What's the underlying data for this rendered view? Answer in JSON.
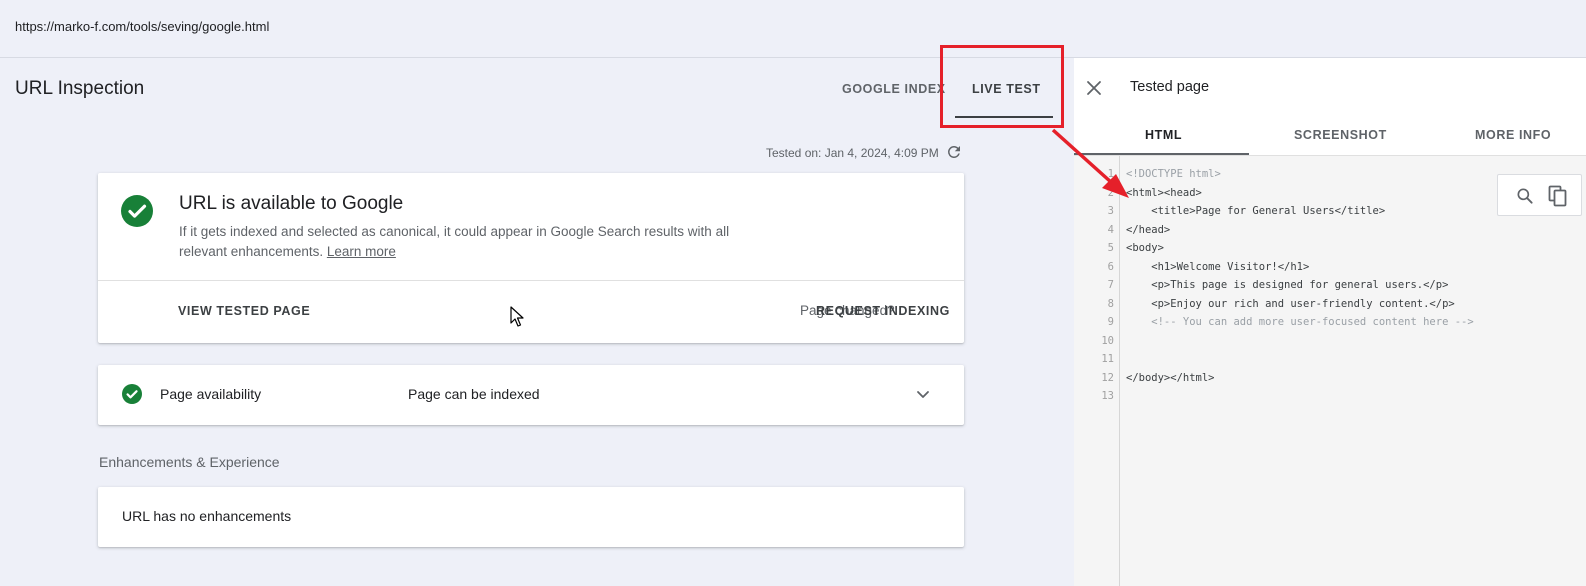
{
  "address_bar": {
    "url": "https://marko-f.com/tools/seving/google.html"
  },
  "header": {
    "title": "URL Inspection",
    "tabs": [
      {
        "label": "GOOGLE INDEX"
      },
      {
        "label": "LIVE TEST",
        "selected": true
      }
    ]
  },
  "test_info": {
    "tested_on": "Tested on: Jan 4, 2024, 4:09 PM"
  },
  "status_card": {
    "title": "URL is available to Google",
    "description": "If it gets indexed and selected as canonical, it could appear in Google Search results with all relevant enhancements.",
    "learn_more": "Learn more",
    "view_tested_page": "VIEW TESTED PAGE",
    "page_changed": "Page changed?",
    "request_indexing": "REQUEST INDEXING"
  },
  "availability": {
    "label": "Page availability",
    "value": "Page can be indexed"
  },
  "enhancements": {
    "section_title": "Enhancements & Experience",
    "message": "URL has no enhancements"
  },
  "side_panel": {
    "title": "Tested page",
    "tabs": [
      {
        "label": "HTML",
        "selected": true
      },
      {
        "label": "SCREENSHOT"
      },
      {
        "label": "MORE INFO"
      }
    ],
    "code_lines": [
      {
        "num": "1",
        "text": "<!DOCTYPE html>"
      },
      {
        "num": "2",
        "text": "<html><head>"
      },
      {
        "num": "3",
        "text": "    <title>Page for General Users</title>"
      },
      {
        "num": "4",
        "text": "</head>"
      },
      {
        "num": "5",
        "text": "<body>"
      },
      {
        "num": "6",
        "text": "    <h1>Welcome Visitor!</h1>"
      },
      {
        "num": "7",
        "text": "    <p>This page is designed for general users.</p>"
      },
      {
        "num": "8",
        "text": "    <p>Enjoy our rich and user-friendly content.</p>"
      },
      {
        "num": "9",
        "text": "    <!-- You can add more user-focused content here -->"
      },
      {
        "num": "10",
        "text": ""
      },
      {
        "num": "11",
        "text": ""
      },
      {
        "num": "12",
        "text": "</body></html>"
      },
      {
        "num": "13",
        "text": ""
      }
    ]
  },
  "icons": {
    "check": "check-circle-icon",
    "refresh": "refresh-icon",
    "chevron": "chevron-down-icon",
    "close": "close-icon",
    "search": "search-icon",
    "copy": "copy-icon",
    "cursor": "mouse-cursor-icon"
  },
  "colors": {
    "success_green": "#188038",
    "annotation_red": "#e5202a",
    "background": "#eef0f8"
  }
}
